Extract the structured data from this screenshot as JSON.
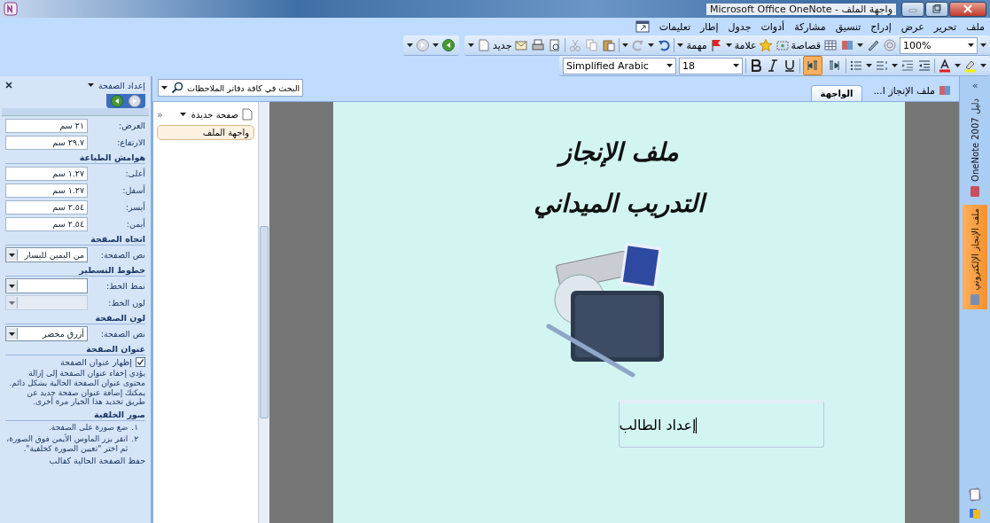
{
  "window": {
    "title": "Microsoft Office OneNote - واجهة الملف"
  },
  "menu": [
    "ملف",
    "تحرير",
    "عرض",
    "إدراج",
    "تنسيق",
    "مشاركة",
    "أدوات",
    "جدول",
    "إطار",
    "تعليمات"
  ],
  "standard_toolbar": {
    "zoom": "100%",
    "clip_label": "قصاصة",
    "tag_label": "علامة",
    "task_label": "مهمة",
    "new_label": "جديد"
  },
  "formatting_toolbar": {
    "font": "Simplified Arabic",
    "size": "18",
    "direction_buttons": [
      {
        "selected": false
      },
      {
        "selected": true
      }
    ]
  },
  "task_pane": {
    "title": "إعداد الصفحة",
    "items": [
      {
        "kind": "field",
        "label": "العرض:",
        "value": "٢١ سم"
      },
      {
        "kind": "field",
        "label": "الارتفاع:",
        "value": "٢٩.٧ سم"
      },
      {
        "kind": "heading",
        "text": "هوامش الطباعة"
      },
      {
        "kind": "field",
        "label": "أعلى:",
        "value": "١.٢٧ سم"
      },
      {
        "kind": "field",
        "label": "أسفل:",
        "value": "١.٢٧ سم"
      },
      {
        "kind": "field",
        "label": "أيسر:",
        "value": "٢.٥٤ سم"
      },
      {
        "kind": "field",
        "label": "أيمن:",
        "value": "٢.٥٤ سم"
      },
      {
        "kind": "heading",
        "text": "اتجاه الصفحة"
      },
      {
        "kind": "dropdown",
        "label": "نص الصفحة:",
        "value": "من اليمين لليسار",
        "disabled": false
      },
      {
        "kind": "heading",
        "text": "خطوط التسطير"
      },
      {
        "kind": "dropdown",
        "label": "نمط الخط:",
        "value": "",
        "disabled": false
      },
      {
        "kind": "dropdown",
        "label": "لون الخط:",
        "value": "",
        "disabled": true
      },
      {
        "kind": "heading",
        "text": "لون الصفحة"
      },
      {
        "kind": "dropdown",
        "label": "نص الصفحة:",
        "value": "أزرق مخضر",
        "disabled": false
      },
      {
        "kind": "heading",
        "text": "عنوان الصفحة"
      },
      {
        "kind": "checkbox",
        "label": "إظهار عنوان الصفحة",
        "checked": true
      },
      {
        "kind": "paragraph",
        "text": "يؤدي إخفاء عنوان الصفحة إلى إزالة محتوى عنوان الصفحة الحالية بشكل دائم. يمكنك إضافة عنوان صفحة جديد عن طريق تحديد هذا الخيار مرة أخرى."
      },
      {
        "kind": "heading",
        "text": "صور الخلفية"
      },
      {
        "kind": "numbered",
        "number": "١.",
        "text": "ضع صورة على الصفحة."
      },
      {
        "kind": "numbered",
        "number": "٢.",
        "text": "انقر بزر الماوس الأيمن فوق الصورة، ثم اختر \"تعيين الصورة كخلفية\"."
      },
      {
        "kind": "link",
        "text": "حفظ الصفحة الحالية كقالب"
      }
    ]
  },
  "search": {
    "placeholder": "البحث في كافة دفاتر الملاحظات"
  },
  "pages": {
    "collapse": "«",
    "new_page": "صفحة جديدة",
    "items": [
      {
        "title": "واجهة الملف",
        "selected": true
      }
    ]
  },
  "notebook": {
    "label": "ملف الإنجاز ا..."
  },
  "section_tabs": [
    {
      "label": "الواجهة",
      "selected": true
    }
  ],
  "page": {
    "title_lines": [
      "ملف الإنجاز",
      "التدريب الميداني"
    ],
    "note": "إعداد الطالب"
  },
  "navigation_bar": {
    "collapse": "«",
    "notebooks": [
      {
        "label": "دليل OneNote 2007",
        "selected": false,
        "color": "#c8505a"
      },
      {
        "label": "ملف الإنجاز الإلكتروني",
        "selected": true,
        "color": "#7a8fb0"
      }
    ]
  }
}
